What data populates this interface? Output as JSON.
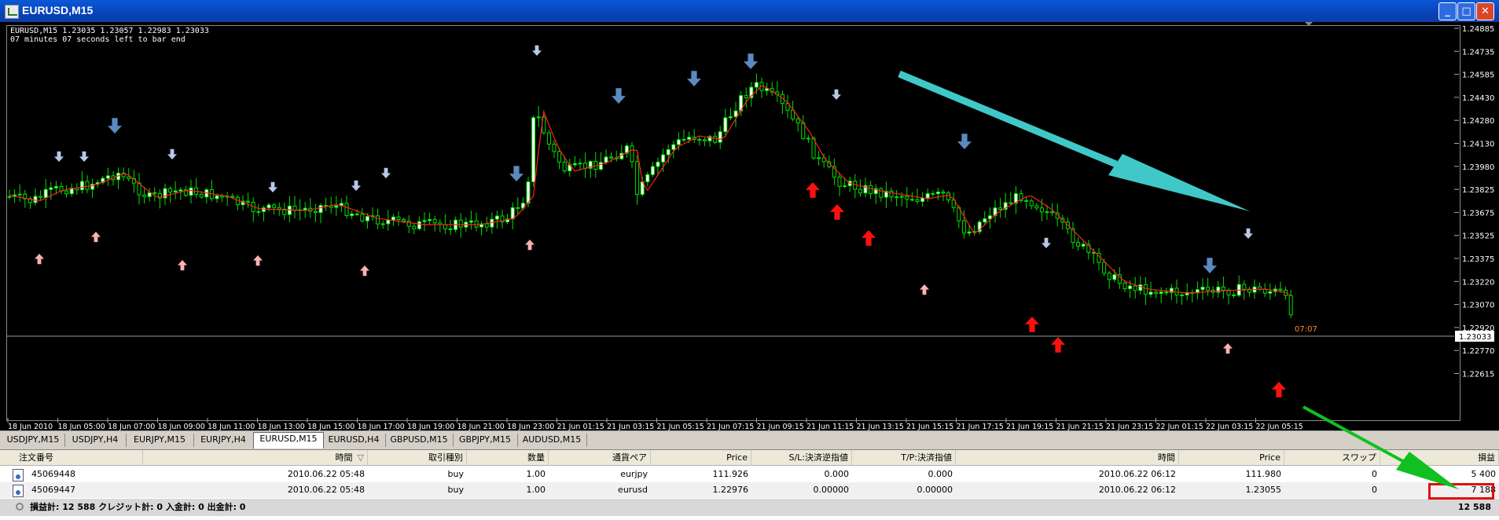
{
  "window": {
    "title": "EURUSD,M15",
    "min_glyph": "_",
    "max_glyph": "□",
    "close_glyph": "✕"
  },
  "chart": {
    "info_line1": "EURUSD,M15  1.23035 1.23057 1.22983 1.23033",
    "info_line2": "07 minutes 07 seconds left to bar end",
    "price_labels": [
      "1.24885",
      "1.24735",
      "1.24585",
      "1.24430",
      "1.24280",
      "1.24130",
      "1.23980",
      "1.23825",
      "1.23675",
      "1.23525",
      "1.23375",
      "1.23220",
      "1.23070",
      "1.22920",
      "1.22770",
      "1.22615"
    ],
    "current_price": "1.23033",
    "timer_label": "07:07",
    "time_labels": [
      "18 Jun 2010",
      "18 Jun 05:00",
      "18 Jun 07:00",
      "18 Jun 09:00",
      "18 Jun 11:00",
      "18 Jun 13:00",
      "18 Jun 15:00",
      "18 Jun 17:00",
      "18 Jun 19:00",
      "18 Jun 21:00",
      "18 Jun 23:00",
      "21 Jun 01:15",
      "21 Jun 03:15",
      "21 Jun 05:15",
      "21 Jun 07:15",
      "21 Jun 09:15",
      "21 Jun 11:15",
      "21 Jun 13:15",
      "21 Jun 15:15",
      "21 Jun 17:15",
      "21 Jun 19:15",
      "21 Jun 21:15",
      "21 Jun 23:15",
      "22 Jun 01:15",
      "22 Jun 03:15",
      "22 Jun 05:15"
    ],
    "colors": {
      "background": "#000000",
      "bull": "#ffffff",
      "bear": "#00e000",
      "ma": "#ff2020",
      "buy_strong": "#ff1010",
      "buy_weak": "#ffb0b0",
      "sell_strong": "#5a8ac0",
      "sell_weak": "#b8c8e8",
      "trend_arrow": "#40c8c8",
      "pointer_arrow": "#10c020"
    }
  },
  "tabs": [
    {
      "label": "USDJPY,M15"
    },
    {
      "label": "USDJPY,H4"
    },
    {
      "label": "EURJPY,M15"
    },
    {
      "label": "EURJPY,H4"
    },
    {
      "label": "EURUSD,M15",
      "active": true
    },
    {
      "label": "EURUSD,H4"
    },
    {
      "label": "GBPUSD,M15"
    },
    {
      "label": "GBPJPY,M15"
    },
    {
      "label": "AUDUSD,M15"
    }
  ],
  "terminal": {
    "headers": [
      "注文番号",
      "時間",
      "取引種別",
      "数量",
      "通貨ペア",
      "Price",
      "S/L:決済逆指値",
      "T/P:決済指値",
      "時間",
      "Price",
      "スワップ",
      "損益"
    ],
    "sort_glyph": "▽",
    "rows": [
      [
        "45069448",
        "2010.06.22 05:48",
        "buy",
        "1.00",
        "eurjpy",
        "111.926",
        "0.000",
        "0.000",
        "2010.06.22 06:12",
        "111.980",
        "0",
        "5 400"
      ],
      [
        "45069447",
        "2010.06.22 05:48",
        "buy",
        "1.00",
        "eurusd",
        "1.22976",
        "0.00000",
        "0.00000",
        "2010.06.22 06:12",
        "1.23055",
        "0",
        "7 188"
      ]
    ],
    "summary": "損益計: 12 588  クレジット計: 0  入金計: 0  出金計: 0",
    "total": "12 588"
  }
}
